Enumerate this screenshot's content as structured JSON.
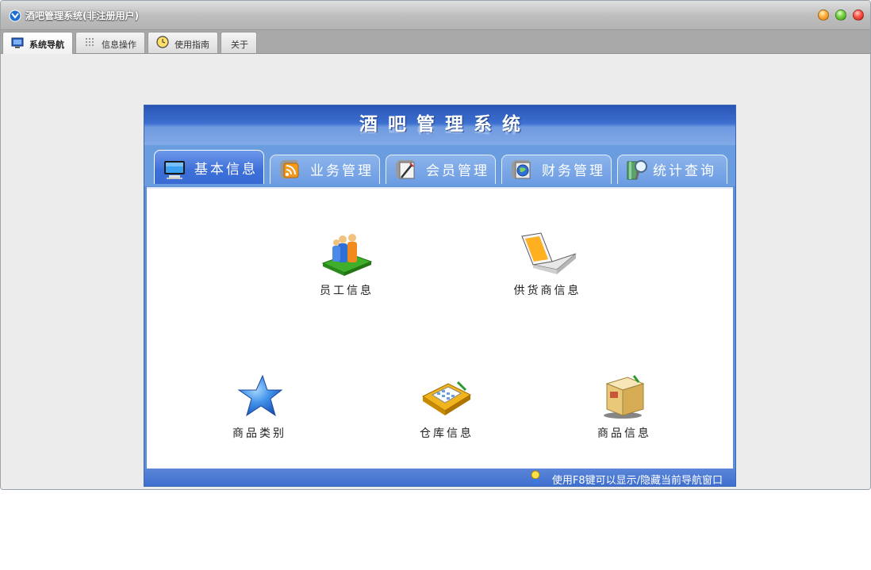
{
  "window": {
    "title": "酒吧管理系统(非注册用户)",
    "icons": {
      "app": "app-logo-icon",
      "minimize": "minimize-icon",
      "maximize": "maximize-icon",
      "close": "close-icon"
    }
  },
  "main_tabs": [
    {
      "label": "系统导航",
      "icon": "monitor-icon",
      "active": true
    },
    {
      "label": "信息操作",
      "icon": "grid-icon",
      "active": false
    },
    {
      "label": "使用指南",
      "icon": "clock-icon",
      "active": false
    },
    {
      "label": "关于",
      "icon": "",
      "active": false
    }
  ],
  "panel": {
    "title": "酒吧管理系统",
    "tabs": [
      {
        "label": "基本信息",
        "icon": "monitor-icon",
        "active": true
      },
      {
        "label": "业务管理",
        "icon": "rss-icon",
        "active": false
      },
      {
        "label": "会员管理",
        "icon": "pen-icon",
        "active": false
      },
      {
        "label": "财务管理",
        "icon": "globe-icon",
        "active": false
      },
      {
        "label": "统计查询",
        "icon": "search-book-icon",
        "active": false
      }
    ],
    "items": [
      {
        "label": "员工信息",
        "icon": "employees-icon"
      },
      {
        "label": "供货商信息",
        "icon": "laptop-supplier-icon"
      },
      {
        "label": "商品类别",
        "icon": "star-icon"
      },
      {
        "label": "仓库信息",
        "icon": "calculator-icon"
      },
      {
        "label": "商品信息",
        "icon": "boxes-icon"
      }
    ],
    "footer": {
      "hint": "使用F8键可以显示/隐藏当前导航窗口",
      "icon": "tip-person-icon"
    }
  },
  "colors": {
    "panel_blue": "#5d8fd9",
    "header_blue": "#2a55b5",
    "window_bg": "#ececec"
  }
}
